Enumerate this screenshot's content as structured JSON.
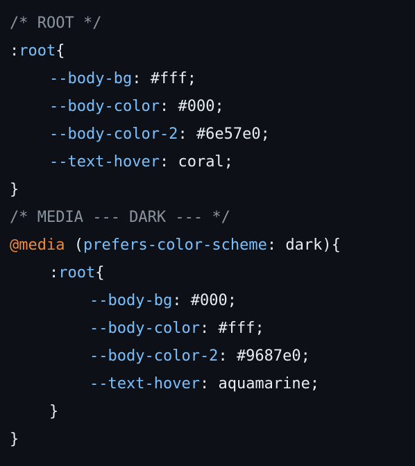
{
  "theme": {
    "background": "#0d1117",
    "text": "#e6edf3",
    "comment": "#8b949e",
    "property": "#79c0ff",
    "at_rule": "#f0883e"
  },
  "code": {
    "line1": {
      "comment": "/* ROOT */"
    },
    "line2": {
      "colon": ":",
      "selector": "root",
      "brace": "{"
    },
    "line3": {
      "property": "--body-bg",
      "sep": ": ",
      "value": "#fff",
      "end": ";"
    },
    "line4": {
      "property": "--body-color",
      "sep": ": ",
      "value": "#000",
      "end": ";"
    },
    "line5": {
      "property": "--body-color-2",
      "sep": ": ",
      "value": "#6e57e0",
      "end": ";"
    },
    "line6": {
      "property": "--text-hover",
      "sep": ": ",
      "value": "coral",
      "end": ";"
    },
    "line7": {
      "brace": "}"
    },
    "line8": {
      "comment": "/* MEDIA --- DARK --- */"
    },
    "line9": {
      "at_rule": "@media",
      "space": " ",
      "open": "(",
      "feature": "prefers-color-scheme",
      "sep": ": ",
      "value": "dark",
      "close": ")",
      "brace": "{"
    },
    "line10": {
      "colon": ":",
      "selector": "root",
      "brace": "{"
    },
    "line11": {
      "property": "--body-bg",
      "sep": ": ",
      "value": "#000",
      "end": ";"
    },
    "line12": {
      "property": "--body-color",
      "sep": ": ",
      "value": "#fff",
      "end": ";"
    },
    "line13": {
      "property": "--body-color-2",
      "sep": ": ",
      "value": "#9687e0",
      "end": ";"
    },
    "line14": {
      "property": "--text-hover",
      "sep": ": ",
      "value": "aquamarine",
      "end": ";"
    },
    "line15": {
      "brace": "}"
    },
    "line16": {
      "brace": "}"
    }
  }
}
